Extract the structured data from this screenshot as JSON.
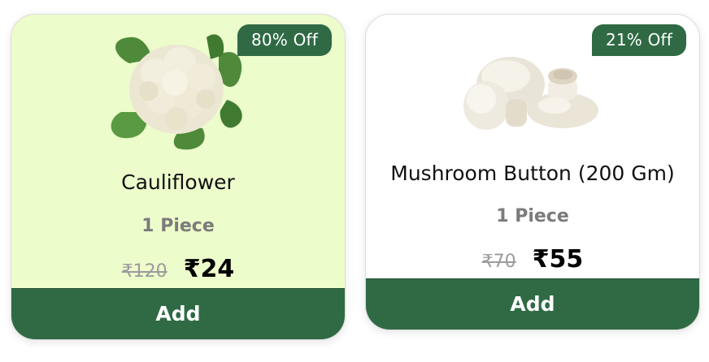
{
  "products": [
    {
      "discount": "80% Off",
      "image_icon": "cauliflower-image",
      "name": "Cauliflower",
      "quantity": "1 Piece",
      "mrp": "₹120",
      "price": "₹24",
      "add_label": "Add",
      "selected": true
    },
    {
      "discount": "21% Off",
      "image_icon": "mushroom-image",
      "name": "Mushroom Button (200 Gm)",
      "quantity": "1 Piece",
      "mrp": "₹70",
      "price": "₹55",
      "add_label": "Add",
      "selected": false
    }
  ],
  "colors": {
    "brand_green": "#2f6a45",
    "selected_card_bg": "#ecfccb",
    "card_bg": "#ffffff",
    "mrp_gray": "#9c9c9c",
    "quantity_gray": "#7b7b7b"
  }
}
